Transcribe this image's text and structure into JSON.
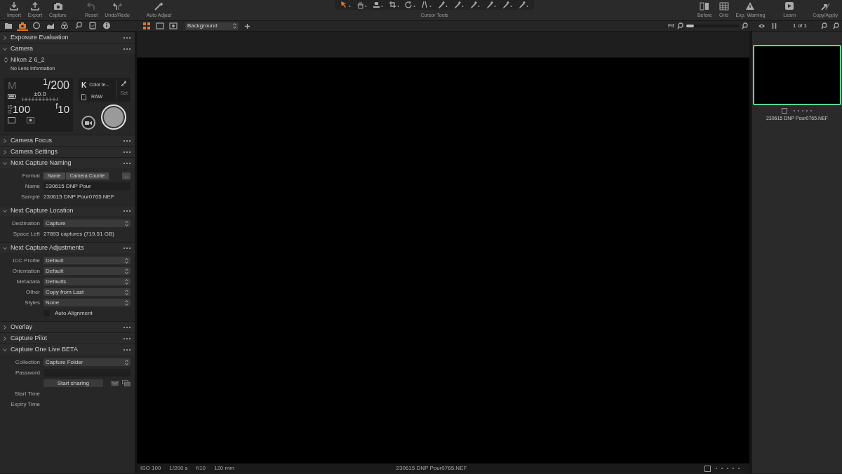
{
  "toolbar": {
    "left": [
      {
        "label": "Import",
        "disabled": false
      },
      {
        "label": "Export",
        "disabled": false
      },
      {
        "label": "Capture",
        "disabled": false
      },
      {
        "label": "Reset",
        "disabled": true
      },
      {
        "label": "Undo/Redo",
        "disabled": false
      },
      {
        "label": "Auto Adjust",
        "disabled": false
      }
    ],
    "cursor_tools": {
      "label": "Cursor Tools",
      "tools": [
        {
          "selected": true
        },
        {
          "selected": false
        },
        {
          "selected": false
        },
        {
          "selected": false
        },
        {
          "selected": false
        },
        {
          "selected": false
        },
        {
          "selected": false
        },
        {
          "selected": false
        },
        {
          "selected": false
        },
        {
          "selected": false
        },
        {
          "selected": false
        },
        {
          "selected": false
        }
      ]
    },
    "right": [
      {
        "label": "Before"
      },
      {
        "label": "Grid"
      },
      {
        "label": "Exp. Warning"
      },
      {
        "label": "Learn"
      },
      {
        "label": "Copy/Apply"
      }
    ]
  },
  "tool_tabs": [
    {
      "selected": false
    },
    {
      "selected": true
    },
    {
      "selected": false
    },
    {
      "selected": false
    },
    {
      "selected": false
    },
    {
      "selected": false
    },
    {
      "selected": false
    },
    {
      "selected": false
    }
  ],
  "panels": [
    {
      "title": "Exposure Evaluation",
      "expanded": false
    },
    {
      "title": "Camera",
      "expanded": true,
      "kind": "camera",
      "camera": {
        "model": "Nikon Z 6_2",
        "lens": "No Lens Information",
        "mode": "M",
        "shutter": "$^{1}$/200",
        "exposure": "±0.0",
        "iso_label": "ISO",
        "iso": "100",
        "aperture": "$^{f}$10",
        "wb_key": "K",
        "wb": "Color te...",
        "format": "RAW",
        "set": "Set"
      }
    },
    {
      "title": "Camera Focus",
      "expanded": false
    },
    {
      "title": "Camera Settings",
      "expanded": false
    },
    {
      "title": "Next Capture Naming",
      "expanded": true,
      "kind": "form",
      "rows": [
        {
          "kind": "tokens",
          "label": "Format",
          "tokens": [
            "Name",
            "Camera Counte"
          ],
          "more": "..."
        },
        {
          "kind": "field",
          "label": "Name",
          "value": "230615 DNP Pour"
        },
        {
          "kind": "text",
          "label": "Sample",
          "value": "230615 DNP Pour0765.NEF"
        }
      ]
    },
    {
      "title": "Next Capture Location",
      "expanded": true,
      "kind": "form",
      "rows": [
        {
          "kind": "select",
          "label": "Destination",
          "value": "Capture"
        },
        {
          "kind": "text",
          "label": "Space Left",
          "value": "27893 captures (719.51 GB)"
        }
      ]
    },
    {
      "title": "Next Capture Adjustments",
      "expanded": true,
      "kind": "form",
      "rows": [
        {
          "kind": "select",
          "label": "ICC Profile",
          "value": "Default"
        },
        {
          "kind": "select",
          "label": "Orientation",
          "value": "Default"
        },
        {
          "kind": "select",
          "label": "Metadata",
          "value": "Defaults"
        },
        {
          "kind": "select",
          "label": "Other",
          "value": "Copy from Last"
        },
        {
          "kind": "select",
          "label": "Styles",
          "value": "None"
        },
        {
          "kind": "checkbox",
          "value": "Auto Alignment",
          "checked": false
        }
      ]
    },
    {
      "title": "Overlay",
      "expanded": false
    },
    {
      "title": "Capture Pilot",
      "expanded": false
    },
    {
      "title": "Capture One Live BETA",
      "expanded": true,
      "kind": "form",
      "rows": [
        {
          "kind": "select",
          "label": "Collection",
          "value": "Capture Folder"
        },
        {
          "kind": "field",
          "label": "Password"
        },
        {
          "kind": "button",
          "value": "Start sharing"
        },
        {
          "kind": "text",
          "label": "Start Time"
        },
        {
          "kind": "text",
          "label": "Expiry Time"
        }
      ]
    }
  ],
  "viewer": {
    "view_modes": [
      {
        "selected": true
      },
      {
        "selected": false
      },
      {
        "selected": false
      }
    ],
    "style": "Background",
    "zoom_label": "Fit",
    "zoom": {
      "level": 0.15
    },
    "status": [
      "ISO 100",
      "1/200 s",
      "f/10",
      "120 mm"
    ],
    "filename": "230615 DNP Pour0765.NEF"
  },
  "browser": {
    "count": "1 of 1",
    "thumbnails": [
      {
        "filename": "230615 DNP Pour0765.NEF",
        "selected": true
      }
    ]
  }
}
